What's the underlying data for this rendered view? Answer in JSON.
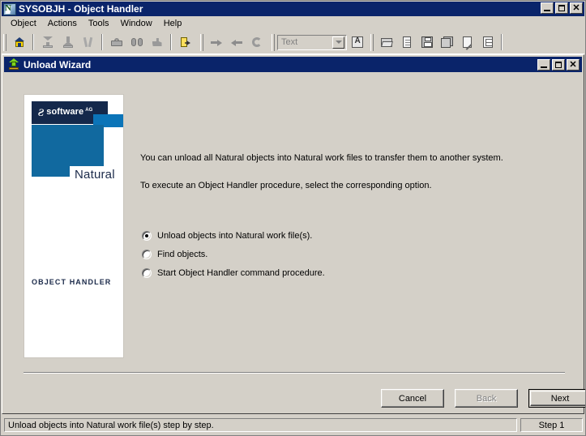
{
  "window": {
    "title": "SYSOBJH - Object Handler",
    "icon": "natural-app-icon",
    "controls": {
      "minimize": "_",
      "maximize": "□",
      "close": "✕"
    }
  },
  "menubar": {
    "items": [
      {
        "label": "Object",
        "name": "menu-object"
      },
      {
        "label": "Actions",
        "name": "menu-actions"
      },
      {
        "label": "Tools",
        "name": "menu-tools"
      },
      {
        "label": "Window",
        "name": "menu-window"
      },
      {
        "label": "Help",
        "name": "menu-help"
      }
    ]
  },
  "toolbar": {
    "buttons": [
      {
        "name": "home-icon",
        "title": "Home"
      },
      {
        "name": "load-icon",
        "title": "Load"
      },
      {
        "name": "unload-icon",
        "title": "Unload"
      },
      {
        "name": "tools-icon",
        "title": "Tools"
      },
      {
        "name": "briefcase-icon",
        "title": "Administration"
      },
      {
        "name": "binoculars-icon",
        "title": "Find"
      },
      {
        "name": "hand-stop-icon",
        "title": "Stop"
      },
      {
        "name": "exit-door-icon",
        "title": "Exit"
      },
      {
        "name": "arrow-right-icon",
        "title": "Forward"
      },
      {
        "name": "arrow-left-icon",
        "title": "Back"
      },
      {
        "name": "refresh-icon",
        "title": "Refresh"
      },
      {
        "name": "text-search-icon",
        "title": "Find Text"
      },
      {
        "name": "open-folder-icon",
        "title": "Open"
      },
      {
        "name": "new-document-icon",
        "title": "New"
      },
      {
        "name": "save-icon",
        "title": "Save"
      },
      {
        "name": "save-all-icon",
        "title": "Save All"
      },
      {
        "name": "edit-document-icon",
        "title": "Edit"
      },
      {
        "name": "list-view-icon",
        "title": "List"
      }
    ],
    "combo": {
      "value": "",
      "placeholder": "Text",
      "options": [
        "Text"
      ]
    }
  },
  "wizard": {
    "title": "Unload Wizard",
    "icon": "unload-up-arrow-icon",
    "controls": {
      "minimize": "_",
      "maximize": "□",
      "close": "✕"
    },
    "sidebar": {
      "brand_mark": "Ƨ",
      "brand_word": "software",
      "brand_sup": "AG",
      "product": "Natural",
      "caption": "OBJECT HANDLER",
      "colors": {
        "navy": "#14284b",
        "blue": "#11699f",
        "strip_blue": "#0b74b8",
        "text_navy": "#1b2a4a"
      }
    },
    "paragraphs": [
      "You can unload all Natural objects into Natural work files to transfer them to another system.",
      "To execute an Object Handler procedure, select the corresponding option."
    ],
    "options": [
      {
        "label": "Unload objects into Natural work file(s).",
        "checked": true,
        "name": "radio-unload-objects"
      },
      {
        "label": "Find objects.",
        "checked": false,
        "name": "radio-find-objects"
      },
      {
        "label": "Start Object Handler command procedure.",
        "checked": false,
        "name": "radio-start-command-procedure"
      }
    ],
    "buttons": {
      "cancel": "Cancel",
      "back": "Back",
      "next": "Next",
      "back_disabled": true,
      "next_default": true
    }
  },
  "statusbar": {
    "message": "Unload objects into Natural work file(s) step by step.",
    "step": "Step 1"
  },
  "theme": {
    "face": "#d4d0c8",
    "titlebar_active": "#0a246a",
    "titlebar_text": "#ffffff",
    "shadow": "#808080",
    "highlight": "#ffffff",
    "dark": "#404040"
  }
}
